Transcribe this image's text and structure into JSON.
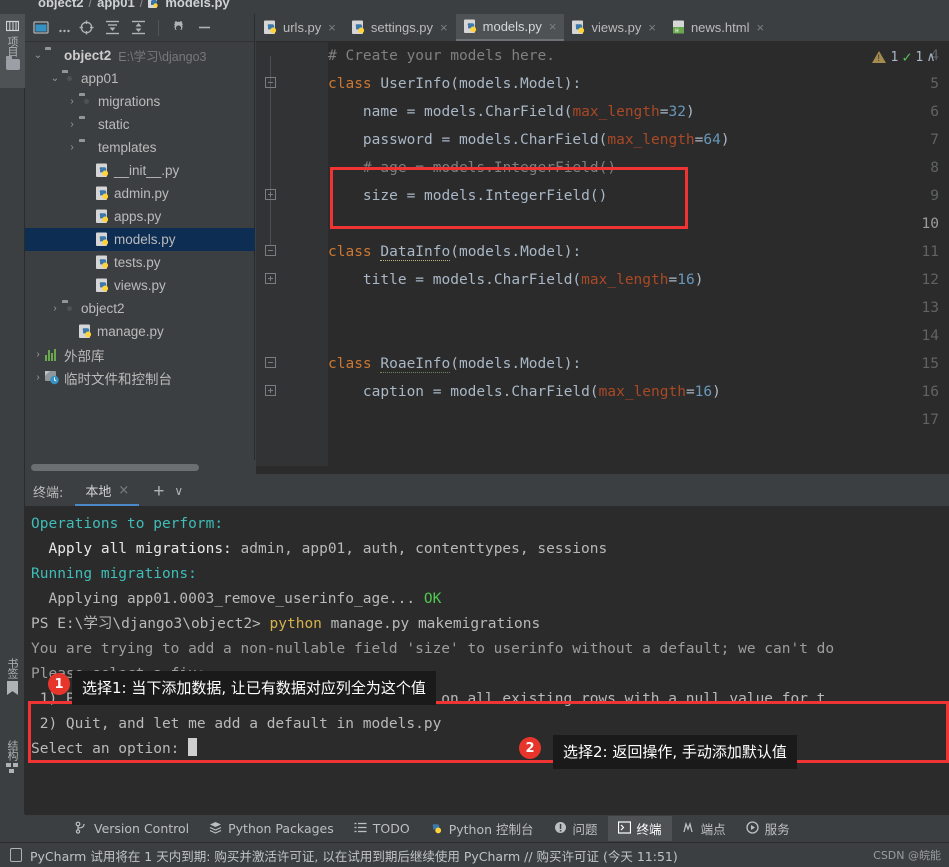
{
  "breadcrumb": {
    "items": [
      "object2",
      "app01",
      "models.py"
    ],
    "separator": "/"
  },
  "left_strip": {
    "project_label": "项目",
    "bookmarks_label": "书签",
    "structure_label": "结构"
  },
  "project_panel": {
    "toolbar_icons": [
      "select-opened-file-icon",
      "more-icon",
      "locate-icon",
      "expand-all-icon",
      "collapse-all-icon",
      "settings-gear-icon",
      "hide-icon"
    ],
    "tree": [
      {
        "depth": 0,
        "arrow": "v",
        "icon": "folder",
        "label": "object2",
        "bold": true,
        "path": "E:\\学习\\django3",
        "selected": false
      },
      {
        "depth": 1,
        "arrow": "v",
        "icon": "module",
        "label": "app01",
        "bold": false,
        "path": "",
        "selected": false
      },
      {
        "depth": 2,
        "arrow": ">",
        "icon": "module",
        "label": "migrations",
        "bold": false,
        "path": "",
        "selected": false
      },
      {
        "depth": 2,
        "arrow": ">",
        "icon": "folder",
        "label": "static",
        "bold": false,
        "path": "",
        "selected": false
      },
      {
        "depth": 2,
        "arrow": ">",
        "icon": "folder",
        "label": "templates",
        "bold": false,
        "path": "",
        "selected": false
      },
      {
        "depth": 3,
        "arrow": "",
        "icon": "python",
        "label": "__init__.py",
        "bold": false,
        "path": "",
        "selected": false
      },
      {
        "depth": 3,
        "arrow": "",
        "icon": "python",
        "label": "admin.py",
        "bold": false,
        "path": "",
        "selected": false
      },
      {
        "depth": 3,
        "arrow": "",
        "icon": "python",
        "label": "apps.py",
        "bold": false,
        "path": "",
        "selected": false
      },
      {
        "depth": 3,
        "arrow": "",
        "icon": "python",
        "label": "models.py",
        "bold": false,
        "path": "",
        "selected": true
      },
      {
        "depth": 3,
        "arrow": "",
        "icon": "python",
        "label": "tests.py",
        "bold": false,
        "path": "",
        "selected": false
      },
      {
        "depth": 3,
        "arrow": "",
        "icon": "python",
        "label": "views.py",
        "bold": false,
        "path": "",
        "selected": false
      },
      {
        "depth": 1,
        "arrow": ">",
        "icon": "module",
        "label": "object2",
        "bold": false,
        "path": "",
        "selected": false
      },
      {
        "depth": 2,
        "arrow": "",
        "icon": "python",
        "label": "manage.py",
        "bold": false,
        "path": "",
        "selected": false
      },
      {
        "depth": 0,
        "arrow": ">",
        "icon": "library",
        "label": "外部库",
        "bold": false,
        "path": "",
        "selected": false
      },
      {
        "depth": 0,
        "arrow": ">",
        "icon": "scratch",
        "label": "临时文件和控制台",
        "bold": false,
        "path": "",
        "selected": false
      }
    ]
  },
  "editor": {
    "tabs": [
      {
        "label": "urls.py",
        "icon": "python-file-icon",
        "active": false,
        "close": "×"
      },
      {
        "label": "settings.py",
        "icon": "python-file-icon",
        "active": false,
        "close": "×"
      },
      {
        "label": "models.py",
        "icon": "python-file-icon",
        "active": true,
        "close": "×"
      },
      {
        "label": "views.py",
        "icon": "python-file-icon",
        "active": false,
        "close": "×"
      },
      {
        "label": "news.html",
        "icon": "html-file-icon",
        "active": false,
        "close": "×"
      }
    ],
    "status": {
      "warning_count": "1",
      "check_count": "1",
      "collapse": "∧"
    },
    "first_line_number": 4,
    "lines": [
      {
        "n": 4,
        "fold": "",
        "html": "<span class='cmt'># Create your models here.</span>"
      },
      {
        "n": 5,
        "fold": "-",
        "html": "<span class='kw'>class</span> UserInfo(models.Model):"
      },
      {
        "n": 6,
        "fold": "",
        "html": "    name = models.CharField(<span class='kwarg'>max_length</span>=<span class='num'>32</span>)"
      },
      {
        "n": 7,
        "fold": "",
        "html": "    password = models.CharField(<span class='kwarg'>max_length</span>=<span class='num'>64</span>)"
      },
      {
        "n": 8,
        "fold": "",
        "html": "    <span class='cmt'># age = models.IntegerField()</span>"
      },
      {
        "n": 9,
        "fold": "+",
        "html": "    size = models.IntegerField()"
      },
      {
        "n": 10,
        "fold": "",
        "html": ""
      },
      {
        "n": 11,
        "fold": "-",
        "html": "<span class='kw'>class</span> <span class='cls-name'>DataInfo</span>(models.Model):"
      },
      {
        "n": 12,
        "fold": "+",
        "html": "    title = models.CharField(<span class='kwarg'>max_length</span>=<span class='num'>16</span>)"
      },
      {
        "n": 13,
        "fold": "",
        "html": ""
      },
      {
        "n": 14,
        "fold": "",
        "html": ""
      },
      {
        "n": 15,
        "fold": "-",
        "html": "<span class='kw'>class</span> <span class='cls-name2'>RoaeInfo</span>(models.Model):"
      },
      {
        "n": 16,
        "fold": "+",
        "html": "    caption = models.CharField(<span class='kwarg'>max_length</span>=<span class='num'>16</span>)"
      },
      {
        "n": 17,
        "fold": "",
        "html": ""
      }
    ]
  },
  "terminal": {
    "title": "终端:",
    "tab_label": "本地",
    "tab_close": "×",
    "new_tab": "+",
    "dropdown": "∨",
    "lines": [
      {
        "html": "<span class='t-cyan'>Operations to perform:</span>"
      },
      {
        "html": "<span class='t-white'>  Apply all migrations:</span> <span class='t-grey'>admin, app01, auth, contenttypes, sessions</span>"
      },
      {
        "html": "<span class='t-cyan'>Running migrations:</span>"
      },
      {
        "html": "<span class='t-grey'>  Applying app01.0003_remove_userinfo_age...</span> <span class='t-green'>OK</span>"
      },
      {
        "html": "<span class='t-grey'>PS E:\\学习\\django3\\object2&gt;</span> <span class='t-yellow'>python</span> <span class='t-grey'>manage.py makemigrations</span>"
      },
      {
        "html": "<span class='t-dim'>You are trying to add a non-nullable field 'size' to userinfo without a default; we can't do</span>"
      },
      {
        "html": "<span class='t-dim'>Please select a fix:</span>"
      },
      {
        "html": "<span class='t-grey'> 1) Provide a one-off default now (will be set on all existing rows with a null value for t</span>"
      },
      {
        "html": "<span class='t-grey'> 2) Quit, and let me add a default in models.py</span>"
      },
      {
        "html": "<span class='t-grey'>Select an option: </span><span class='cursor-blk'></span>"
      }
    ]
  },
  "annotations": [
    {
      "id": "1",
      "badge": "1",
      "label": "选择1: 当下添加数据, 让已有数据对应列全为这个值"
    },
    {
      "id": "2",
      "badge": "2",
      "label": "选择2: 返回操作, 手动添加默认值"
    }
  ],
  "tool_windows_bar": {
    "items": [
      {
        "label": "Version Control",
        "icon": "branch-icon",
        "active": false
      },
      {
        "label": "Python Packages",
        "icon": "packages-icon",
        "active": false
      },
      {
        "label": "TODO",
        "icon": "todo-list-icon",
        "active": false
      },
      {
        "label": "Python 控制台",
        "icon": "python-console-icon",
        "active": false
      },
      {
        "label": "问题",
        "icon": "problems-icon",
        "active": false
      },
      {
        "label": "终端",
        "icon": "terminal-icon",
        "active": true
      },
      {
        "label": "端点",
        "icon": "endpoints-icon",
        "active": false
      },
      {
        "label": "服务",
        "icon": "services-icon",
        "active": false
      }
    ]
  },
  "status_bar": {
    "icon": "document-icon",
    "message": "PyCharm 试用将在 1 天内到期: 购买并激活许可证, 以在试用到期后继续使用 PyCharm // 购买许可证 (今天 11:51)",
    "watermark": "CSDN @皖能"
  },
  "colors": {
    "accent_blue": "#4a88c7",
    "selection_blue": "#0d2d53",
    "annotation_red": "#f03434",
    "badge_red": "#e8352c",
    "editor_bg": "#2b2b2b",
    "panel_bg": "#3c3f41"
  }
}
